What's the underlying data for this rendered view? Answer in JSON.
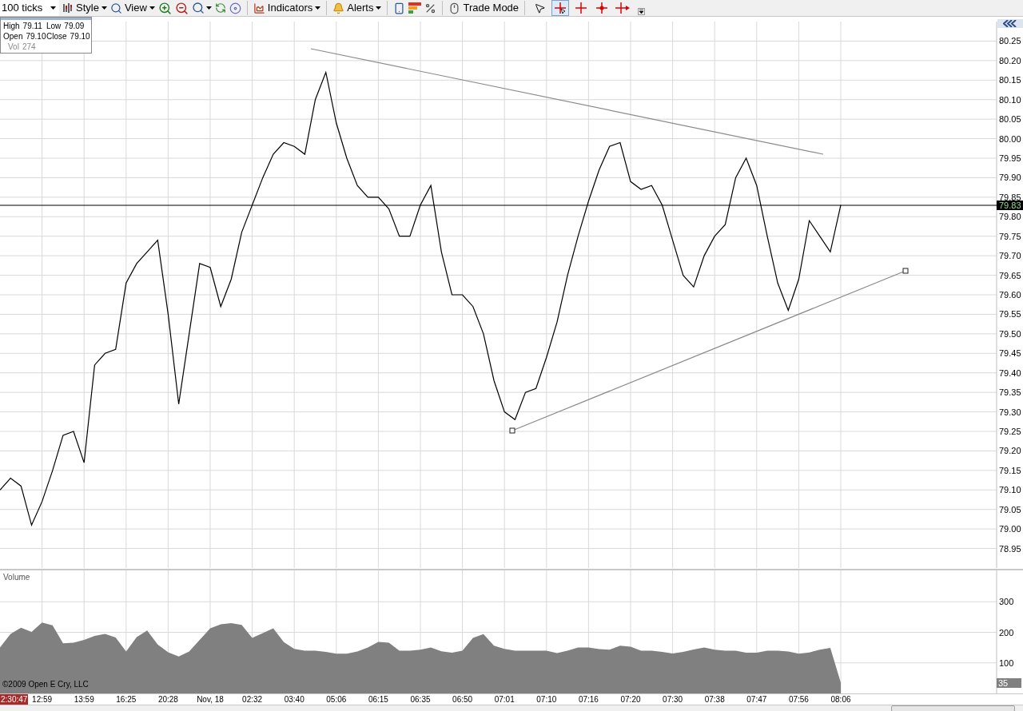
{
  "toolbar": {
    "interval": "100 ticks",
    "style_menu": "Style",
    "view_menu": "View",
    "indicators_menu": "Indicators",
    "alerts_menu": "Alerts",
    "trade_mode": "Trade Mode",
    "cursor_tools": [
      {
        "kind": "pointer",
        "selected": false
      },
      {
        "kind": "crosshair-pointer",
        "selected": true
      },
      {
        "kind": "crosshair",
        "selected": false
      },
      {
        "kind": "crosshair-dot",
        "selected": false
      },
      {
        "kind": "crosshair-arrow",
        "selected": false
      }
    ]
  },
  "info_box": {
    "fields": [
      {
        "label": "High",
        "value": "79.11",
        "dimmed": false
      },
      {
        "label": "Low",
        "value": "79.09",
        "dimmed": false
      },
      {
        "label": "Open",
        "value": "79.10",
        "dimmed": false
      },
      {
        "label": "Close",
        "value": "79.10",
        "dimmed": false
      },
      {
        "label": "Vol",
        "value": "274",
        "dimmed": true
      }
    ]
  },
  "price_chart": {
    "last_price": "79.83",
    "chart_data": {
      "type": "line",
      "grid": true,
      "series": [
        {
          "color": "#000000",
          "values": [
            79.1,
            79.13,
            79.11,
            79.01,
            79.07,
            79.15,
            79.24,
            79.25,
            79.17,
            79.42,
            79.45,
            79.46,
            79.63,
            79.68,
            79.71,
            79.74,
            79.55,
            79.32,
            79.5,
            79.68,
            79.67,
            79.57,
            79.64,
            79.76,
            79.83,
            79.9,
            79.96,
            79.99,
            79.98,
            79.96,
            80.1,
            80.17,
            80.04,
            79.95,
            79.88,
            79.85,
            79.85,
            79.82,
            79.75,
            79.75,
            79.83,
            79.88,
            79.71,
            79.6,
            79.6,
            79.57,
            79.5,
            79.38,
            79.3,
            79.28,
            79.35,
            79.36,
            79.44,
            79.53,
            79.65,
            79.75,
            79.84,
            79.92,
            79.98,
            79.99,
            79.89,
            79.87,
            79.88,
            79.83,
            79.74,
            79.65,
            79.62,
            79.7,
            79.75,
            79.78,
            79.9,
            79.95,
            79.88,
            79.75,
            79.63,
            79.56,
            79.64,
            79.79,
            79.75,
            79.71,
            79.83
          ]
        }
      ],
      "ylim": [
        78.9,
        80.3
      ],
      "yticks": [
        {
          "value": 78.95,
          "label": "78.95"
        },
        {
          "value": 79,
          "label": "79.00"
        },
        {
          "value": 79.05,
          "label": "79.05"
        },
        {
          "value": 79.1,
          "label": "79.10"
        },
        {
          "value": 79.15,
          "label": "79.15"
        },
        {
          "value": 79.2,
          "label": "79.20"
        },
        {
          "value": 79.25,
          "label": "79.25"
        },
        {
          "value": 79.3,
          "label": "79.30"
        },
        {
          "value": 79.35,
          "label": "79.35"
        },
        {
          "value": 79.4,
          "label": "79.40"
        },
        {
          "value": 79.45,
          "label": "79.45"
        },
        {
          "value": 79.5,
          "label": "79.50"
        },
        {
          "value": 79.55,
          "label": "79.55"
        },
        {
          "value": 79.6,
          "label": "79.60"
        },
        {
          "value": 79.65,
          "label": "79.65"
        },
        {
          "value": 79.7,
          "label": "79.70"
        },
        {
          "value": 79.75,
          "label": "79.75"
        },
        {
          "value": 79.8,
          "label": "79.80"
        },
        {
          "value": 79.85,
          "label": "79.85"
        },
        {
          "value": 79.9,
          "label": "79.90"
        },
        {
          "value": 79.95,
          "label": "79.95"
        },
        {
          "value": 80,
          "label": "80.00"
        },
        {
          "value": 80.05,
          "label": "80.05"
        },
        {
          "value": 80.1,
          "label": "80.10"
        },
        {
          "value": 80.15,
          "label": "80.15"
        },
        {
          "value": 80.2,
          "label": "80.20"
        },
        {
          "value": 80.25,
          "label": "80.25"
        }
      ]
    }
  },
  "volume_pane": {
    "last_value": "35",
    "copyright": "©2009 Open E Cry, LLC",
    "chart_data": {
      "type": "area",
      "grid": true,
      "categories": [
        null,
        null,
        null,
        null,
        "12:59",
        null,
        null,
        null,
        "13:59",
        null,
        null,
        null,
        "16:25",
        null,
        null,
        null,
        "20:28",
        null,
        null,
        null,
        "Nov, 18",
        null,
        null,
        null,
        "02:32",
        null,
        null,
        null,
        "03:40",
        null,
        null,
        null,
        "05:06",
        null,
        null,
        null,
        "06:15",
        null,
        null,
        null,
        "06:35",
        null,
        null,
        null,
        "06:50",
        null,
        null,
        null,
        "07:01",
        null,
        null,
        null,
        "07:10",
        null,
        null,
        null,
        "07:16",
        null,
        null,
        null,
        "07:20",
        null,
        null,
        null,
        "07:30",
        null,
        null,
        null,
        "07:38",
        null,
        null,
        null,
        "07:47",
        null,
        null,
        null,
        "07:56",
        null,
        null,
        null,
        "08:06"
      ],
      "series": [
        {
          "name": "Volume",
          "color": "#808080",
          "values": [
            150,
            195,
            215,
            201,
            232,
            223,
            164,
            166,
            175,
            188,
            195,
            183,
            137,
            184,
            206,
            160,
            135,
            121,
            137,
            175,
            213,
            226,
            230,
            224,
            182,
            197,
            213,
            168,
            146,
            140,
            140,
            136,
            130,
            130,
            137,
            150,
            169,
            166,
            140,
            140,
            143,
            150,
            138,
            133,
            140,
            182,
            194,
            156,
            146,
            140,
            140,
            140,
            140,
            132,
            140,
            150,
            150,
            145,
            143,
            156,
            153,
            140,
            140,
            136,
            131,
            136,
            144,
            150,
            143,
            140,
            140,
            133,
            133,
            140,
            140,
            137,
            130,
            134,
            143,
            149,
            35
          ]
        }
      ],
      "ylim": [
        0,
        400
      ],
      "yticks": [
        100,
        200,
        300
      ]
    }
  },
  "time_axis": {
    "bar_timer": "2:30:47"
  }
}
